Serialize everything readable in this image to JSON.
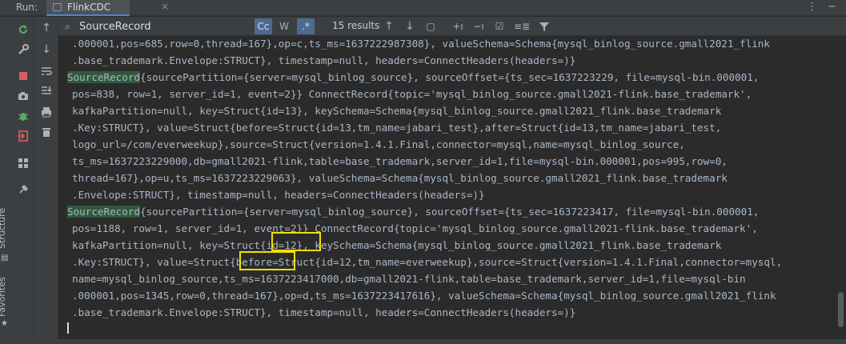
{
  "titlebar": {
    "run_label": "Run:",
    "tab_label": "FlinkCDC",
    "close_glyph": "×",
    "more_glyph": "⋮",
    "minimize_glyph": "−"
  },
  "search": {
    "value": "SourceRecord",
    "match_case_label": "Cc",
    "whole_word_label": "W",
    "regex_label": ".*",
    "results_text": "15 results"
  },
  "sidebar": {
    "structure_label": "Structure",
    "favorites_label": "Favorites"
  },
  "icons": {
    "rerun": "rerun-icon",
    "tool": "wrench-icon",
    "stop": "stop-icon",
    "camera": "camera-icon",
    "bug": "bug-icon",
    "exit": "exit-icon",
    "layout": "layout-icon",
    "pin": "pin-icon",
    "up": "arrow-up-icon",
    "down": "arrow-down-icon",
    "wrap": "soft-wrap-icon",
    "scroll_end": "scroll-to-end-icon",
    "print": "print-icon",
    "trash": "trash-icon",
    "filter": "filter-icon"
  },
  "colors": {
    "highlight": "#32593d",
    "box": "#f0e000",
    "background": "#2b2b2b"
  },
  "console": {
    "lines": [
      {
        "text": ".000001,pos=685,row=0,thread=167},op=c,ts_ms=1637222987308}, valueSchema=Schema{mysql_binlog_source.gmall2021_flink"
      },
      {
        "text": ".base_trademark.Envelope:STRUCT}, timestamp=null, headers=ConnectHeaders(headers=)}"
      },
      {
        "hl": "SourceRecord",
        "text": "{sourcePartition={server=mysql_binlog_source}, sourceOffset={ts_sec=1637223229, file=mysql-bin.000001,"
      },
      {
        "text": "pos=838, row=1, server_id=1, event=2}} ConnectRecord{topic='mysql_binlog_source.gmall2021-flink.base_trademark',"
      },
      {
        "text": "kafkaPartition=null, key=Struct{id=13}, keySchema=Schema{mysql_binlog_source.gmall2021_flink.base_trademark"
      },
      {
        "text": ".Key:STRUCT}, value=Struct{before=Struct{id=13,tm_name=jabari_test},after=Struct{id=13,tm_name=jabari_test,"
      },
      {
        "text": "logo_url=/com/everweekup},source=Struct{version=1.4.1.Final,connector=mysql,name=mysql_binlog_source,"
      },
      {
        "text": "ts_ms=1637223229000,db=gmall2021-flink,table=base_trademark,server_id=1,file=mysql-bin.000001,pos=995,row=0,"
      },
      {
        "text": "thread=167},op=u,ts_ms=1637223229063}, valueSchema=Schema{mysql_binlog_source.gmall2021_flink.base_trademark"
      },
      {
        "text": ".Envelope:STRUCT}, timestamp=null, headers=ConnectHeaders(headers=)}"
      },
      {
        "hl": "SourceRecord",
        "text": "{sourcePartition={server=mysql_binlog_source}, sourceOffset={ts_sec=1637223417, file=mysql-bin.000001,"
      },
      {
        "text": "pos=1188, row=1, server_id=1, event=2}} ConnectRecord{topic='mysql_binlog_source.gmall2021-flink.base_trademark',"
      },
      {
        "text": "kafkaPartition=null, key=Struct{id=12}, keySchema=Schema{mysql_binlog_source.gmall2021_flink.base_trademark"
      },
      {
        "text": ".Key:STRUCT}, value=Struct{before=Struct{id=12,tm_name=everweekup},source=Struct{version=1.4.1.Final,connector=mysql,"
      },
      {
        "text": "name=mysql_binlog_source,ts_ms=1637223417000,db=gmall2021-flink,table=base_trademark,server_id=1,file=mysql-bin"
      },
      {
        "text": ".000001,pos=1345,row=0,thread=167},op=d,ts_ms=1637223417616}, valueSchema=Schema{mysql_binlog_source.gmall2021_flink"
      },
      {
        "text": ".base_trademark.Envelope:STRUCT}, timestamp=null, headers=ConnectHeaders(headers=)}"
      }
    ]
  }
}
